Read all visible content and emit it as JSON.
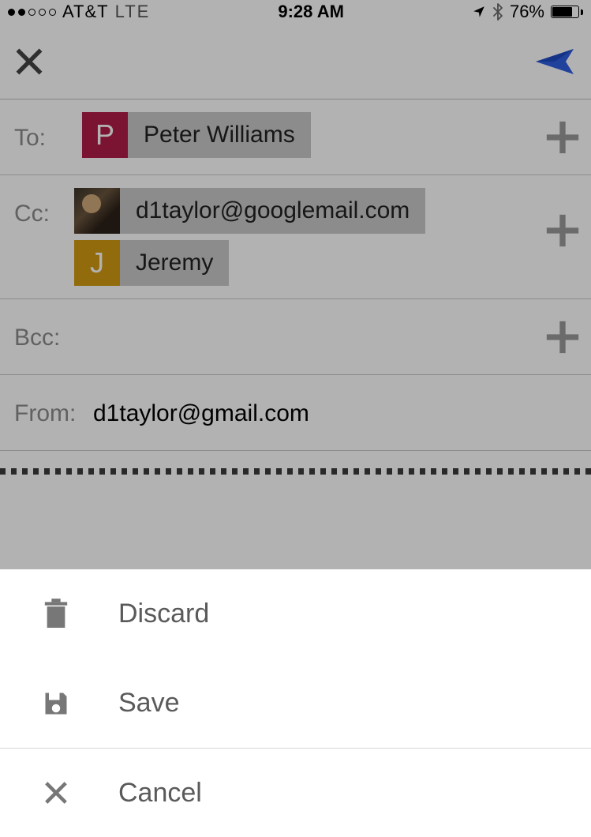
{
  "status": {
    "carrier": "AT&T",
    "network": "LTE",
    "time": "9:28 AM",
    "battery_pct": "76%"
  },
  "compose": {
    "to_label": "To:",
    "cc_label": "Cc:",
    "bcc_label": "Bcc:",
    "from_label": "From:",
    "to": [
      {
        "initial": "P",
        "name": "Peter Williams",
        "avatar": "p"
      }
    ],
    "cc": [
      {
        "initial": "",
        "name": "d1taylor@googlemail.com",
        "avatar": "photo"
      },
      {
        "initial": "J",
        "name": "Jeremy",
        "avatar": "j"
      }
    ],
    "from_value": "d1taylor@gmail.com"
  },
  "sheet": {
    "discard": "Discard",
    "save": "Save",
    "cancel": "Cancel"
  },
  "colors": {
    "send_blue": "#2f5fe0",
    "avatar_p": "#b11e48",
    "avatar_j": "#d19a12",
    "chip_bg": "#c9c9c9",
    "muted": "#8b8b8b"
  }
}
